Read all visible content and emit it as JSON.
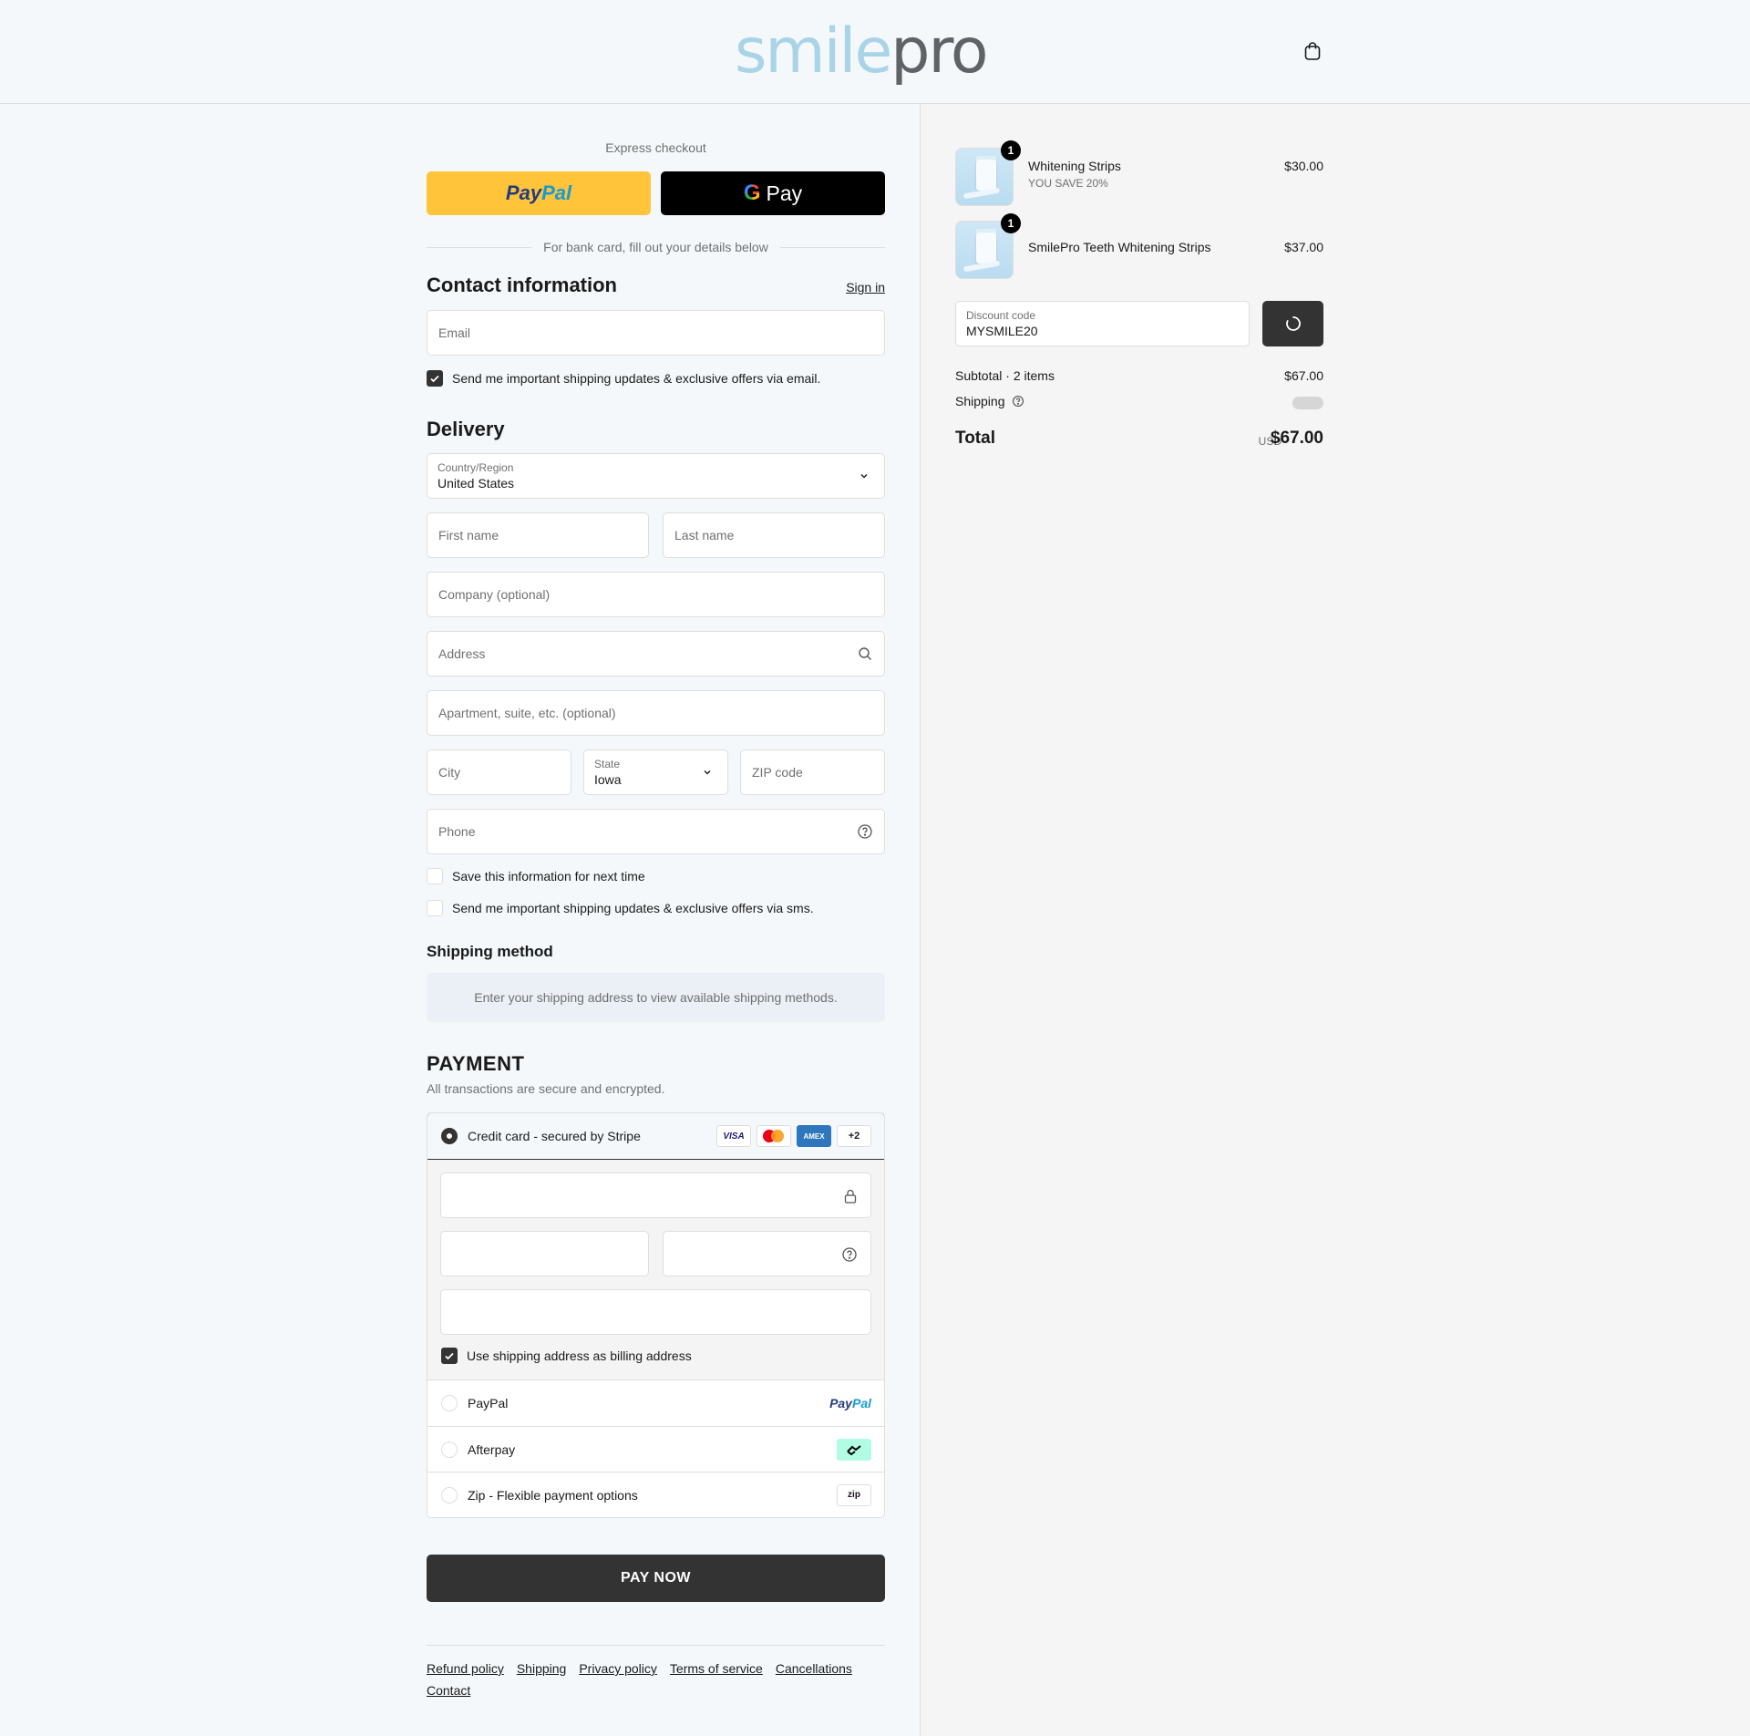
{
  "header": {
    "logo_part1": "smile",
    "logo_part2": "pro",
    "cart_icon": "shopping-bag-icon"
  },
  "express": {
    "label": "Express checkout",
    "paypal_label_1": "Pay",
    "paypal_label_2": "Pal",
    "gpay_g": "G",
    "gpay_label": "Pay",
    "divider_text": "For bank card, fill out your details below"
  },
  "contact": {
    "title": "Contact information",
    "sign_in": "Sign in",
    "email_placeholder": "Email",
    "email_optin": "Send me important shipping updates & exclusive offers via email.",
    "email_optin_checked": true
  },
  "delivery": {
    "title": "Delivery",
    "country_label": "Country/Region",
    "country_value": "United States",
    "first_name_placeholder": "First name",
    "last_name_placeholder": "Last name",
    "company_placeholder": "Company (optional)",
    "address_placeholder": "Address",
    "apartment_placeholder": "Apartment, suite, etc. (optional)",
    "city_placeholder": "City",
    "state_label": "State",
    "state_value": "Iowa",
    "zip_placeholder": "ZIP code",
    "phone_placeholder": "Phone",
    "save_info": "Save this information for next time",
    "save_info_checked": false,
    "sms_optin": "Send me important shipping updates & exclusive offers via sms.",
    "sms_optin_checked": false
  },
  "shipping_method": {
    "title": "Shipping method",
    "note": "Enter your shipping address to view available shipping methods."
  },
  "payment": {
    "title": "PAYMENT",
    "subtitle": "All transactions are secure and encrypted.",
    "credit_card_label": "Credit card - secured by Stripe",
    "card_badges": [
      "VISA",
      "mastercard",
      "AMEX",
      "+2"
    ],
    "billing_same": "Use shipping address as billing address",
    "billing_same_checked": true,
    "paypal_label": "PayPal",
    "afterpay_label": "Afterpay",
    "zip_label": "Zip - Flexible payment options",
    "zip_logo": "zip",
    "pay_now": "PAY NOW"
  },
  "footer": {
    "links": [
      "Refund policy",
      "Shipping",
      "Privacy policy",
      "Terms of service",
      "Cancellations",
      "Contact"
    ]
  },
  "order": {
    "items": [
      {
        "name": "Whitening Strips",
        "sub": "YOU SAVE 20%",
        "price": "$30.00",
        "qty": "1"
      },
      {
        "name": "SmilePro Teeth Whitening Strips",
        "sub": "",
        "price": "$37.00",
        "qty": "1"
      }
    ],
    "discount_label": "Discount code",
    "discount_value": "MYSMILE20",
    "subtotal_label": "Subtotal · 2 items",
    "subtotal_value": "$67.00",
    "shipping_label": "Shipping",
    "total_label": "Total",
    "total_currency": "USD",
    "total_value": "$67.00"
  },
  "colors": {
    "page_bg": "#f4f8fb",
    "summary_bg": "#f5f5f5",
    "primary_button": "#333333",
    "paypal_yellow": "#ffc439",
    "logo_light": "#a9d4e8",
    "logo_dark": "#5f6368"
  }
}
